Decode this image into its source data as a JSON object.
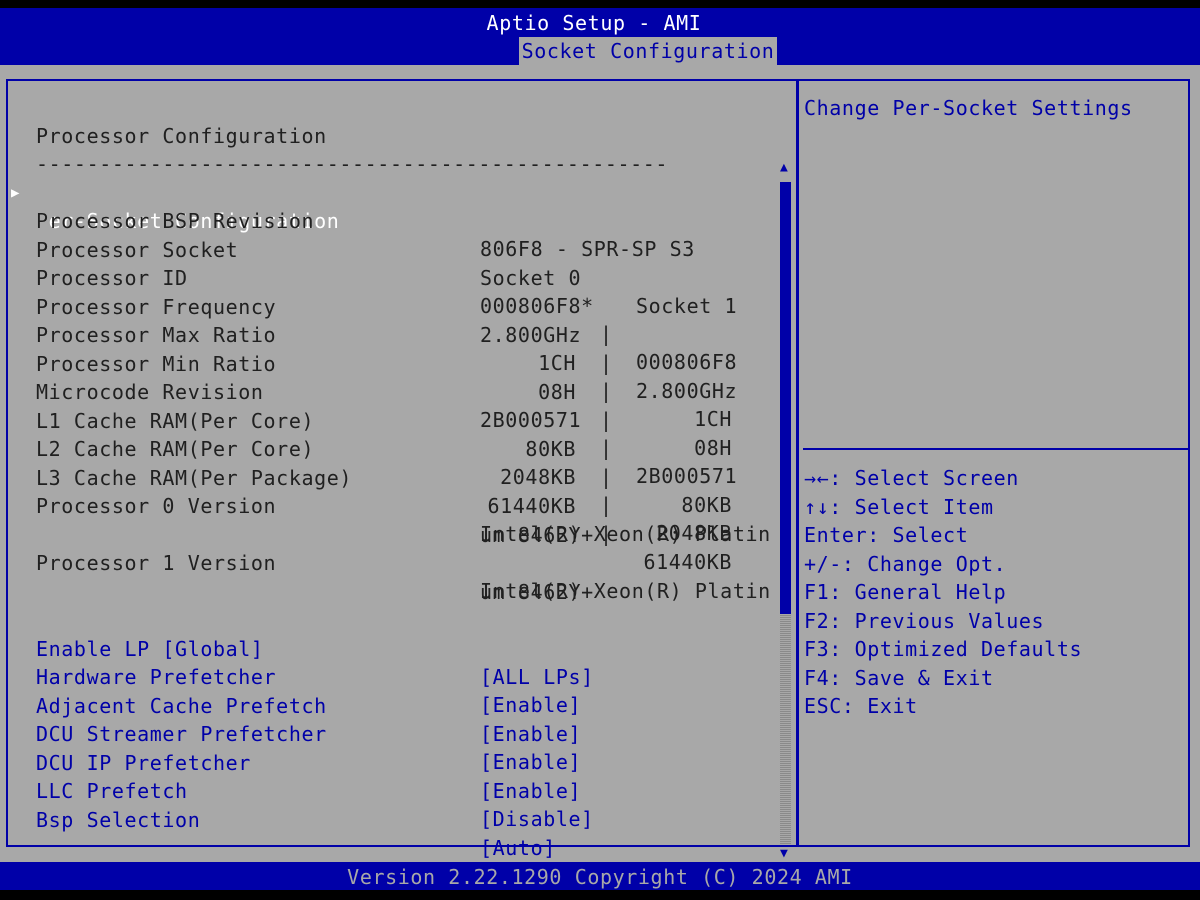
{
  "header": {
    "title": "Aptio Setup - AMI",
    "active_tab": "Socket Configuration"
  },
  "section": {
    "title": "Processor Configuration",
    "separator": "--------------------------------------------------"
  },
  "submenu": {
    "label": "Per-Socket Configuration"
  },
  "info": {
    "bsp_revision": {
      "label": "Processor BSP Revision",
      "value": "806F8 - SPR-SP S3"
    },
    "socket": {
      "label": "Processor Socket",
      "s0": "Socket 0",
      "s1": "Socket 1"
    },
    "rows": [
      {
        "label": "Processor ID",
        "s0": "000806F8*",
        "s1": "000806F8"
      },
      {
        "label": "Processor Frequency",
        "s0": "2.800GHz",
        "s1": "2.800GHz"
      },
      {
        "label": "Processor Max Ratio",
        "s0": "1CH",
        "s1": "1CH"
      },
      {
        "label": "Processor Min Ratio",
        "s0": "08H",
        "s1": "08H"
      },
      {
        "label": "Microcode Revision",
        "s0": "2B000571",
        "s1": "2B000571"
      },
      {
        "label": "L1 Cache RAM(Per Core)",
        "s0": "80KB",
        "s1": "80KB"
      },
      {
        "label": "L2 Cache RAM(Per Core)",
        "s0": "2048KB",
        "s1": "2048KB"
      },
      {
        "label": "L3 Cache RAM(Per Package)",
        "s0": "61440KB",
        "s1": "61440KB"
      }
    ],
    "column_separator": "|",
    "proc0_version": {
      "label": "Processor 0 Version",
      "line1": "Intel(R) Xeon(R) Platin",
      "line2": "um 8462Y+"
    },
    "proc1_version": {
      "label": "Processor 1 Version",
      "line1": "Intel(R) Xeon(R) Platin",
      "line2": "um 8462Y+"
    }
  },
  "options": [
    {
      "label": "Enable LP [Global]",
      "value": "[ALL LPs]"
    },
    {
      "label": "Hardware Prefetcher",
      "value": "[Enable]"
    },
    {
      "label": "Adjacent Cache Prefetch",
      "value": "[Enable]"
    },
    {
      "label": "DCU Streamer Prefetcher",
      "value": "[Enable]"
    },
    {
      "label": "DCU IP Prefetcher",
      "value": "[Enable]"
    },
    {
      "label": "LLC Prefetch",
      "value": "[Disable]"
    },
    {
      "label": "Bsp Selection",
      "value": "[Auto]"
    }
  ],
  "help_text": "Change Per-Socket Settings",
  "key_help": [
    "→←: Select Screen",
    "↑↓: Select Item",
    "Enter: Select",
    "+/-: Change Opt.",
    "F1: General Help",
    "F2: Previous Values",
    "F3: Optimized Defaults",
    "F4: Save & Exit",
    "ESC: Exit"
  ],
  "footer": "Version 2.22.1290 Copyright (C) 2024 AMI",
  "colors": {
    "background": "#a8a8a8",
    "accent_blue": "#0000a8",
    "text": "#202020",
    "selected": "#ffffff"
  },
  "icons": {
    "submenu_marker": "triangle-right-icon",
    "scroll_up": "triangle-up-icon",
    "scroll_down": "triangle-down-icon"
  }
}
